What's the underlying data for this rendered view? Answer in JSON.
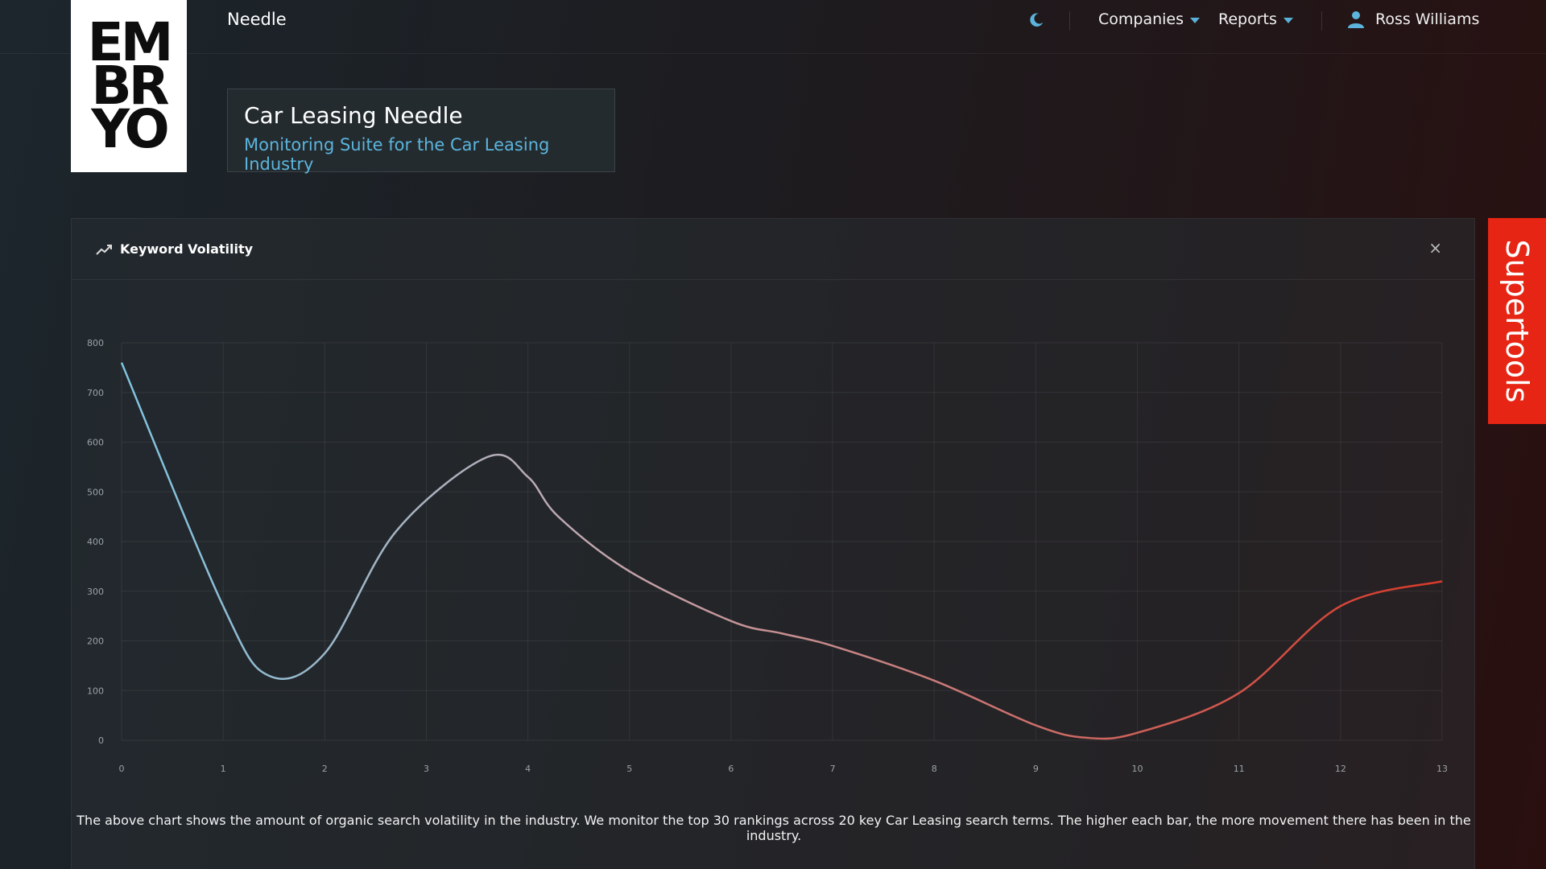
{
  "app": {
    "name": "Needle",
    "logo_lines": [
      "EM",
      "BR",
      "YO"
    ]
  },
  "nav": {
    "theme_toggle_icon": "moon-icon",
    "companies_label": "Companies",
    "reports_label": "Reports",
    "user_name": "Ross Williams",
    "user_icon": "user-icon"
  },
  "header": {
    "title": "Car Leasing Needle",
    "subtitle": "Monitoring Suite for the Car Leasing Industry"
  },
  "panel": {
    "title": "Keyword Volatility",
    "title_icon": "trending-up-icon",
    "close_label": "×",
    "caption": "The above chart shows the amount of organic search volatility in the industry. We monitor the top 30 rankings across 20 key Car Leasing search terms. The higher each bar, the more movement there has been in the industry."
  },
  "supertools_label": "Supertools",
  "colors": {
    "accent_blue": "#5cb4dc",
    "line_start": "#7fc4e0",
    "line_mid": "#c0a8b0",
    "line_end": "#d83a2a",
    "supertools_bg": "#e62514"
  },
  "chart_data": {
    "type": "line",
    "title": "",
    "xlabel": "",
    "ylabel": "",
    "xlim": [
      0,
      13
    ],
    "ylim": [
      0,
      800
    ],
    "x_ticks": [
      0,
      1,
      2,
      3,
      4,
      5,
      6,
      7,
      8,
      9,
      10,
      11,
      12,
      13
    ],
    "y_ticks": [
      0,
      100,
      200,
      300,
      400,
      500,
      600,
      700,
      800
    ],
    "grid": true,
    "legend": "none",
    "series": [
      {
        "x": [
          0,
          1,
          1.45,
          2,
          2.7,
          3.6,
          4,
          4.3,
          5,
          6,
          6.5,
          7,
          8,
          9,
          9.5,
          10,
          11,
          12,
          13
        ],
        "values": [
          760,
          270,
          130,
          175,
          420,
          570,
          530,
          450,
          340,
          240,
          215,
          190,
          120,
          30,
          5,
          15,
          95,
          270,
          320
        ]
      }
    ]
  }
}
